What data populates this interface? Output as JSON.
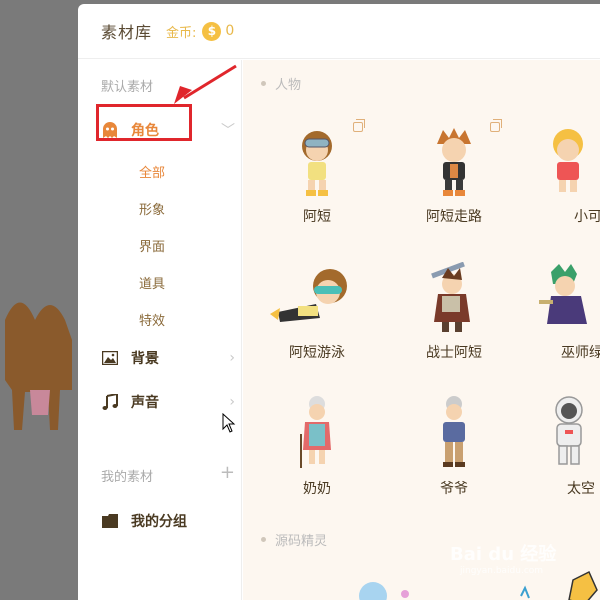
{
  "header": {
    "title": "素材库",
    "coin_label": "金币:",
    "coin_symbol": "$",
    "coin_count": "0"
  },
  "sidebar": {
    "default_label": "默认素材",
    "items": [
      {
        "label": "角色",
        "icon": "ghost-icon"
      },
      {
        "label": "背景",
        "icon": "image-icon"
      },
      {
        "label": "声音",
        "icon": "music-note-icon"
      }
    ],
    "sub_items": [
      "全部",
      "形象",
      "界面",
      "道具",
      "特效"
    ],
    "my_label": "我的素材",
    "my_group": "我的分组",
    "plus": "+"
  },
  "content": {
    "group1": "人物",
    "characters": [
      {
        "name": "阿短"
      },
      {
        "name": "阿短走路"
      },
      {
        "name": "小可"
      },
      {
        "name": "阿短游泳"
      },
      {
        "name": "战士阿短"
      },
      {
        "name": "巫师绿"
      },
      {
        "name": "奶奶"
      },
      {
        "name": "爷爷"
      },
      {
        "name": "太空"
      }
    ],
    "group2": "源码精灵"
  },
  "watermark": {
    "brand": "Bai du 经验",
    "url": "jingyan.baidu.com"
  },
  "colors": {
    "accent": "#e8873a",
    "highlight": "#e0262c",
    "coin": "#f5c043"
  }
}
